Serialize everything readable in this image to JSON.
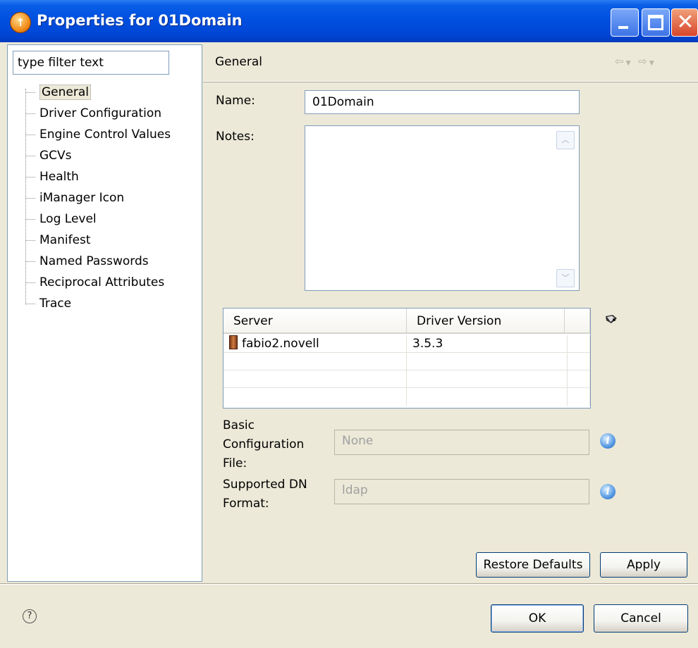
{
  "window": {
    "title": "Properties for 01Domain",
    "title_icon": "app-orb-icon"
  },
  "filter": {
    "placeholder": "type filter text",
    "value": "type filter text"
  },
  "tree": {
    "items": [
      {
        "label": "General",
        "selected": true
      },
      {
        "label": "Driver Configuration"
      },
      {
        "label": "Engine Control Values"
      },
      {
        "label": "GCVs"
      },
      {
        "label": "Health"
      },
      {
        "label": "iManager Icon"
      },
      {
        "label": "Log Level"
      },
      {
        "label": "Manifest"
      },
      {
        "label": "Named Passwords"
      },
      {
        "label": "Reciprocal Attributes"
      },
      {
        "label": "Trace"
      }
    ]
  },
  "page": {
    "title": "General",
    "nav": {
      "back_icon": "back-arrow-icon",
      "forward_icon": "forward-arrow-icon"
    }
  },
  "form": {
    "name_label": "Name:",
    "name_value": "01Domain",
    "notes_label": "Notes:",
    "notes_value": "",
    "basic_config_label_1": "Basic",
    "basic_config_label_2": "Configuration",
    "basic_config_label_3": "File:",
    "basic_config_value": "None",
    "dn_format_label_1": "Supported DN",
    "dn_format_label_2": "Format:",
    "dn_format_value": "ldap"
  },
  "table": {
    "columns": [
      "Server",
      "Driver Version"
    ],
    "rows": [
      {
        "server": "fabio2.novell",
        "version": "3.5.3"
      }
    ]
  },
  "buttons": {
    "restore_defaults": "Restore Defaults",
    "apply": "Apply",
    "ok": "OK",
    "cancel": "Cancel"
  },
  "colors": {
    "titlebar": "#0050e0",
    "dialog_bg": "#ece9d8",
    "close_button": "#d8452a"
  }
}
